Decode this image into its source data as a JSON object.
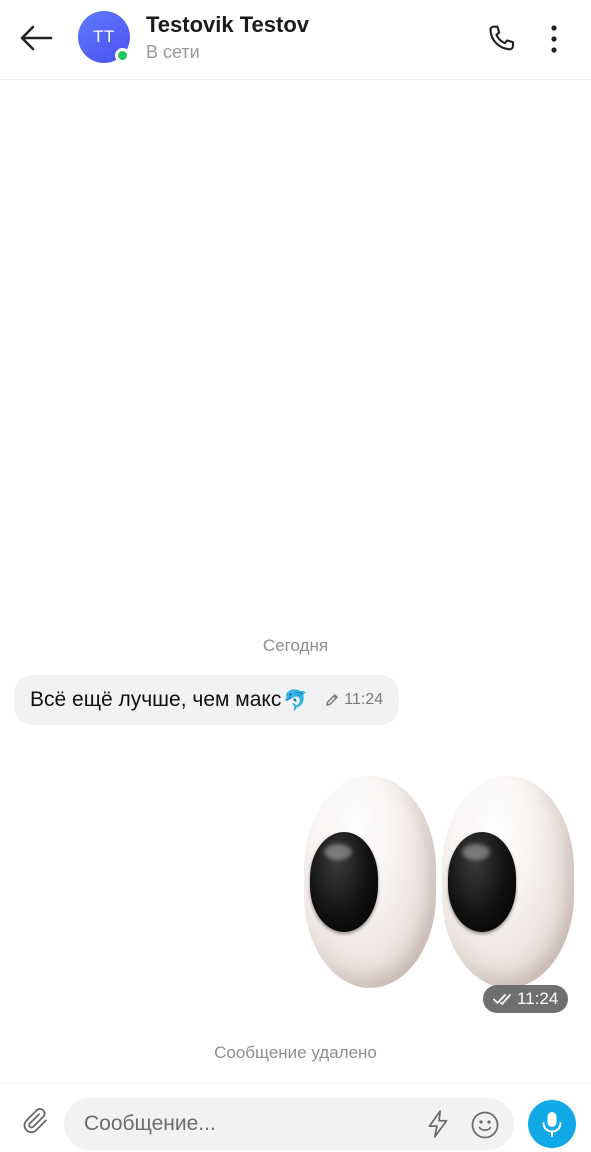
{
  "header": {
    "back_icon": "arrow-left-icon",
    "avatar_initials": "TT",
    "contact_name": "Testovik Testov",
    "status": "В сети",
    "call_icon": "phone-icon",
    "menu_icon": "more-vertical-icon"
  },
  "chat": {
    "date_separator": "Сегодня",
    "messages": [
      {
        "direction": "incoming",
        "text": "Всё ещё лучше, чем макс",
        "emoji": "🐬",
        "edited": true,
        "time": "11:24"
      },
      {
        "direction": "outgoing",
        "type": "sticker",
        "sticker": "eyes",
        "read": true,
        "time": "11:24"
      }
    ],
    "deleted_notice": "Сообщение удалено"
  },
  "composer": {
    "attach_icon": "paperclip-icon",
    "placeholder": "Сообщение...",
    "value": "",
    "bolt_icon": "lightning-icon",
    "emoji_icon": "smiley-icon",
    "mic_icon": "microphone-icon"
  },
  "colors": {
    "accent": "#10a8e6",
    "avatar": "#5060f5",
    "online": "#22c55e",
    "incoming_bubble": "#f2f2f4",
    "time_badge": "#6f6f6f"
  }
}
